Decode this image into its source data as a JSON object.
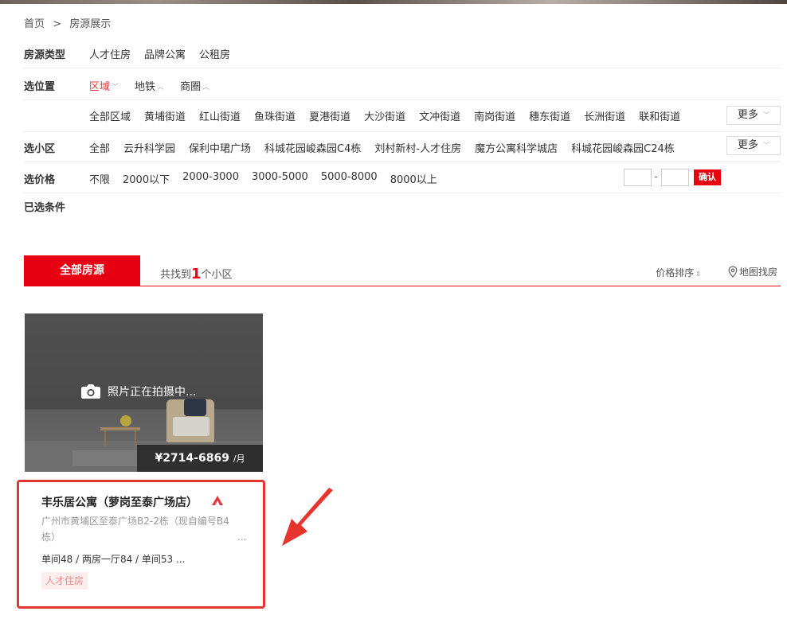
{
  "breadcrumb": {
    "home": "首页",
    "separator": ">",
    "current": "房源展示"
  },
  "filters": {
    "house_type": {
      "label": "房源类型",
      "options": [
        "人才住房",
        "品牌公寓",
        "公租房"
      ]
    },
    "location": {
      "label": "选位置",
      "options": [
        "区域",
        "地铁",
        "商圈"
      ],
      "active_index": 0
    },
    "region": {
      "options": [
        "全部区域",
        "黄埔街道",
        "红山街道",
        "鱼珠街道",
        "夏港街道",
        "大沙街道",
        "文冲街道",
        "南岗街道",
        "穗东街道",
        "长洲街道",
        "联和街道"
      ],
      "more_label": "更多"
    },
    "community": {
      "label": "选小区",
      "options": [
        "全部",
        "云升科学园",
        "保利中珺广场",
        "科城花园峻森园C4栋",
        "刘村新村-人才住房",
        "魔方公寓科学城店",
        "科城花园峻森园C24栋"
      ],
      "more_label": "更多"
    },
    "price": {
      "label": "选价格",
      "options": [
        "不限",
        "2000以下",
        "2000-3000",
        "3000-5000",
        "5000-8000",
        "8000以上"
      ],
      "range_dash": "-",
      "confirm_label": "确认"
    },
    "selected": {
      "label": "已选条件"
    }
  },
  "results_bar": {
    "tab_all": "全部房源",
    "found_prefix": "共找到",
    "found_count": "1",
    "found_suffix": "个小区",
    "sort_label": "价格排序",
    "map_label": "地图找房"
  },
  "listing": {
    "photo_notice": "照片正在拍摄中...",
    "price": "¥2714-6869",
    "price_unit": "/月",
    "title": "丰乐居公寓（萝岗至泰广场店）",
    "address_line1": "广州市黄埔区至泰广场B2-2栋（现自编号B4",
    "address_line2": "栋）",
    "address_ellipsis": "...",
    "rooms": "单间48 / 两房一厅84 / 单间53 ...",
    "tag": "人才住房"
  },
  "colors": {
    "brand_red": "#e60012",
    "highlight_red": "#e8342f"
  }
}
